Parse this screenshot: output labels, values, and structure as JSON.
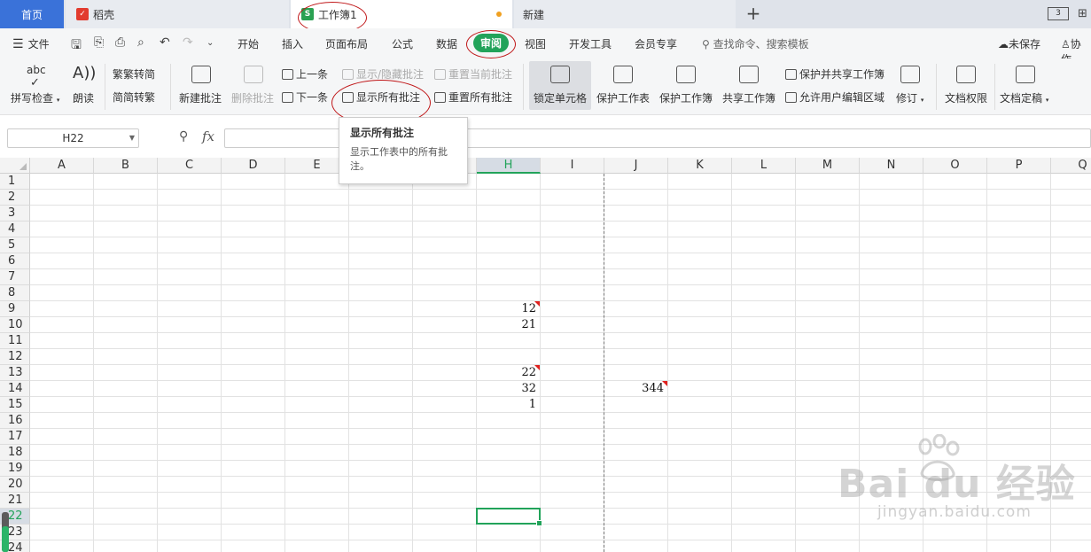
{
  "tabs": {
    "home": "首页",
    "daoke": "稻壳",
    "workbook": "工作簿1",
    "new": "新建",
    "add": "+",
    "layout_icon": "3"
  },
  "menu": {
    "file": "文件",
    "items": [
      "开始",
      "插入",
      "页面布局",
      "公式",
      "数据",
      "审阅",
      "视图",
      "开发工具",
      "会员专享"
    ],
    "active": "审阅",
    "search": "查找命令、搜索模板",
    "unsaved": "未保存",
    "collab": "协作"
  },
  "ribbon": {
    "spell_check": "拼写检查",
    "spell_abc": "abc",
    "read_aloud": "朗读",
    "trad_to_simp": "繁转简",
    "simp_to_trad": "简转繁",
    "new_comment": "新建批注",
    "delete_comment": "删除批注",
    "prev": "上一条",
    "next": "下一条",
    "show_hide_comment": "显示/隐藏批注",
    "show_all_comments": "显示所有批注",
    "reset_current_comment": "重置当前批注",
    "reset_all_comments": "重置所有批注",
    "lock_cell": "锁定单元格",
    "protect_sheet": "保护工作表",
    "protect_workbook": "保护工作簿",
    "share_workbook": "共享工作簿",
    "protect_and_share": "保护并共享工作簿",
    "allow_edit_ranges": "允许用户编辑区域",
    "revise": "修订",
    "doc_permission": "文档权限",
    "doc_finalize": "文档定稿"
  },
  "formula_bar": {
    "name_box": "H22",
    "fx": "fx",
    "value": ""
  },
  "tooltip": {
    "title": "显示所有批注",
    "description": "显示工作表中的所有批注。"
  },
  "sheet": {
    "columns": [
      "A",
      "B",
      "C",
      "D",
      "E",
      "F",
      "G",
      "H",
      "I",
      "J",
      "K",
      "L",
      "M",
      "N",
      "O",
      "P",
      "Q"
    ],
    "selected_column": "H",
    "rows": [
      "1",
      "2",
      "3",
      "4",
      "5",
      "6",
      "7",
      "8",
      "9",
      "10",
      "11",
      "12",
      "13",
      "14",
      "15",
      "16",
      "17",
      "18",
      "19",
      "20",
      "21",
      "22",
      "23",
      "24"
    ],
    "selected_row": "22",
    "cells": [
      {
        "ref": "H9",
        "value": "12",
        "comment": true
      },
      {
        "ref": "H10",
        "value": "21",
        "comment": false
      },
      {
        "ref": "H13",
        "value": "22",
        "comment": true
      },
      {
        "ref": "H14",
        "value": "32",
        "comment": false
      },
      {
        "ref": "H15",
        "value": "1",
        "comment": false
      },
      {
        "ref": "J14",
        "value": "344",
        "comment": true
      }
    ]
  },
  "watermark": {
    "brand": "Bai du 经验",
    "url": "jingyan.baidu.com"
  },
  "colors": {
    "accent_green": "#22a35a",
    "home_tab_blue": "#3a72d9",
    "comment_red": "#e0201e",
    "annotation_red": "#c0181a"
  }
}
